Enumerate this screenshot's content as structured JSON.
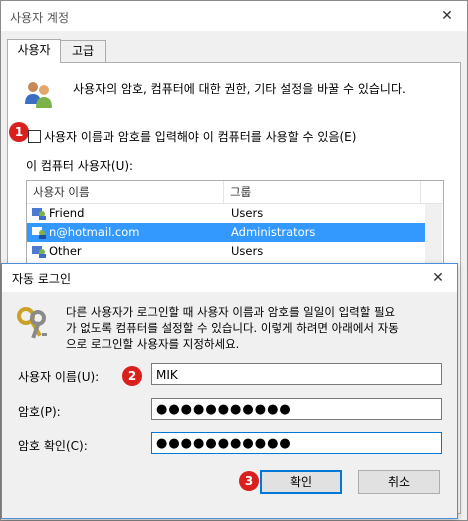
{
  "outer_window": {
    "title": "사용자 계정",
    "tabs": [
      "사용자",
      "고급"
    ],
    "intro_text": "사용자의 암호, 컴퓨터에 대한 권한, 기타 설정을 바꿀 수 있습니다.",
    "checkbox_label": "사용자 이름과 암호를 입력해야 이 컴퓨터를 사용할 수 있음(E)",
    "checkbox_checked": false,
    "users_label": "이 컴퓨터 사용자(U):",
    "list_headers": [
      "사용자 이름",
      "그룹"
    ],
    "users": [
      {
        "name": "Friend",
        "group": "Users",
        "selected": false
      },
      {
        "name": "n@hotmail.com",
        "group": "Administrators",
        "selected": true
      },
      {
        "name": "Other",
        "group": "Users",
        "selected": false
      }
    ],
    "close_icon": "close-icon"
  },
  "dialog": {
    "title": "자동 로그인",
    "description_line1": "다른 사용자가 로그인할 때 사용자 이름과 암호를 일일이 입력할 필요",
    "description_line2": "가 없도록 컴퓨터를 설정할 수 있습니다. 이렇게 하려면 아래에서 자동",
    "description_line3": "으로 로그인할 사용자를 지정하세요.",
    "username_label": "사용자 이름(U):",
    "username_value": "MIK",
    "password_label": "암호(P):",
    "password_value": "●●●●●●●●●●●",
    "confirm_label": "암호 확인(C):",
    "confirm_value": "●●●●●●●●●●●",
    "ok_label": "확인",
    "cancel_label": "취소",
    "close_icon": "close-icon"
  },
  "badges": {
    "one": "1",
    "two": "2",
    "three": "3",
    "color": "#d9201c"
  },
  "colors": {
    "selection": "#3399ff",
    "focus": "#0078d7"
  }
}
